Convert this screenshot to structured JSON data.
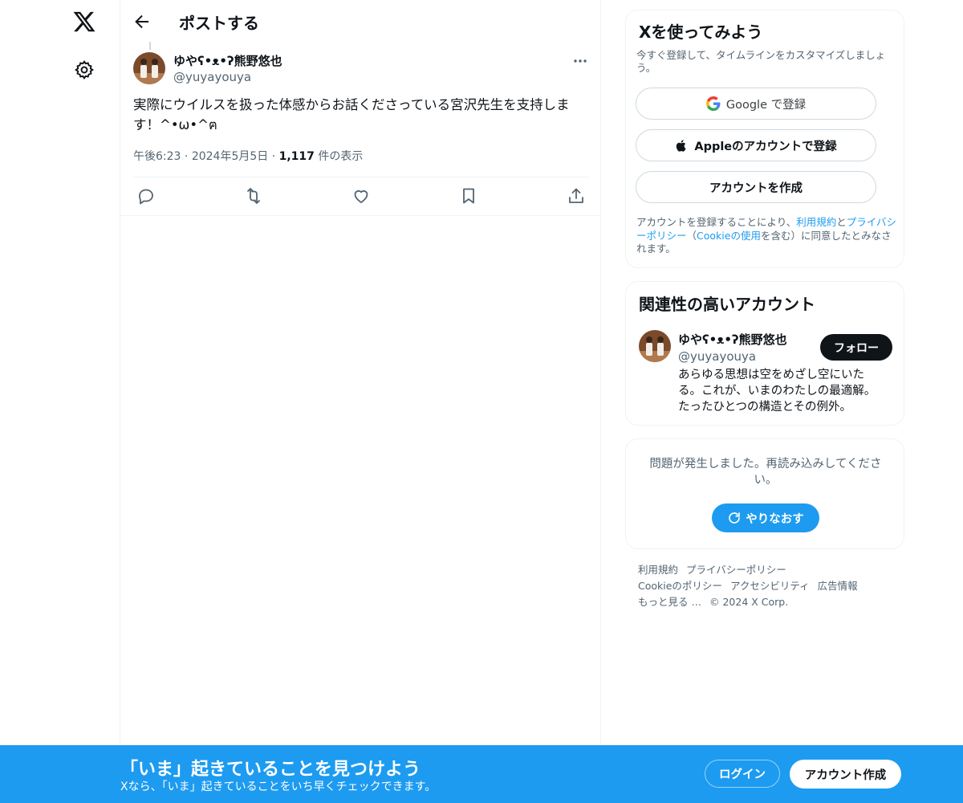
{
  "nav": {
    "logo_icon": "x-logo-icon",
    "settings_icon": "gear-icon"
  },
  "header": {
    "title": "ポストする",
    "back_icon": "arrow-left-icon"
  },
  "post": {
    "author_name": "ゆやʕ•ᴥ•ʔ熊野悠也",
    "author_handle": "@yuyayouya",
    "text": "実際にウイルスを扱った体感からお話くださっている宮沢先生を支持します！^•ω•^ฅ",
    "time": "午後6:23",
    "date": "2024年5月5日",
    "views_count": "1,117",
    "views_label": "件の表示",
    "separator": "·",
    "action_icons": [
      "reply-icon",
      "repost-icon",
      "like-icon",
      "bookmark-icon",
      "share-icon"
    ]
  },
  "signup": {
    "title": "Xを使ってみよう",
    "subtitle": "今すぐ登録して、タイムラインをカスタマイズしましょう。",
    "google_label": "Google で登録",
    "apple_label": "Appleのアカウントで登録",
    "create_label": "アカウントを作成",
    "terms_before": "アカウントを登録することにより、",
    "terms_link": "利用規約",
    "terms_and": "と",
    "privacy_link": "プライバシーポリシー",
    "terms_open": "（",
    "cookie_link": "Cookieの使用",
    "terms_after": "を含む）に同意したとみなされます。"
  },
  "related": {
    "title": "関連性の高いアカウント",
    "name": "ゆやʕ•ᴥ•ʔ熊野悠也",
    "handle": "@yuyayouya",
    "bio": "あらゆる思想は空をめざし空にいたる。これが、いまのわたしの最適解。たったひとつの構造とその例外。",
    "follow_label": "フォロー"
  },
  "error": {
    "message": "問題が発生しました。再読み込みしてください。",
    "retry_label": "やりなおす"
  },
  "footer": {
    "links": [
      "利用規約",
      "プライバシーポリシー",
      "Cookieのポリシー",
      "アクセシビリティ",
      "広告情報",
      "もっと見る …"
    ],
    "copyright": "© 2024 X Corp."
  },
  "banner": {
    "title": "「いま」起きていることを見つけよう",
    "subtitle": "Xなら、「いま」起きていることをいち早くチェックできます。",
    "login_label": "ログイン",
    "signup_label": "アカウント作成"
  },
  "colors": {
    "accent": "#1d9bf0",
    "text": "#0f1419",
    "muted": "#536471",
    "border": "#eff3f4"
  }
}
